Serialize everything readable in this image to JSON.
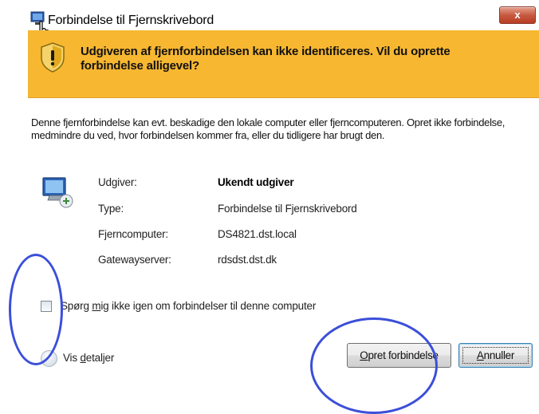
{
  "window": {
    "title": "Forbindelse til Fjernskrivebord",
    "close_glyph": "x"
  },
  "warning": {
    "text": "Udgiveren af fjernforbindelsen kan ikke identificeres. Vil du oprette forbindelse alligevel?",
    "icon": "shield-warning-icon"
  },
  "description": "Denne fjernforbindelse kan evt. beskadige den lokale computer eller fjerncomputeren. Opret ikke forbindelse, medmindre du ved, hvor forbindelsen kommer fra, eller du tidligere har brugt den.",
  "details": {
    "publisher_label": "Udgiver:",
    "publisher_value": "Ukendt udgiver",
    "type_label": "Type:",
    "type_value": "Forbindelse til Fjernskrivebord",
    "remote_label": "Fjerncomputer:",
    "remote_value": "DS4821.dst.local",
    "gateway_label": "Gatewayserver:",
    "gateway_value": "rdsdst.dst.dk"
  },
  "dont_ask": {
    "label_pre": "Spørg ",
    "label_underlined": "m",
    "label_post": "ig ikke igen om forbindelser til denne computer",
    "checked": false
  },
  "show_details": {
    "label_pre": "Vis ",
    "label_underlined": "d",
    "label_post": "etaljer"
  },
  "buttons": {
    "connect_underlined": "O",
    "connect_post": "pret forbindelse",
    "cancel_underlined": "A",
    "cancel_post": "nnuller"
  },
  "colors": {
    "banner": "#f7b731",
    "annotation": "#3b4fd9",
    "close_button": "#c65a42"
  }
}
